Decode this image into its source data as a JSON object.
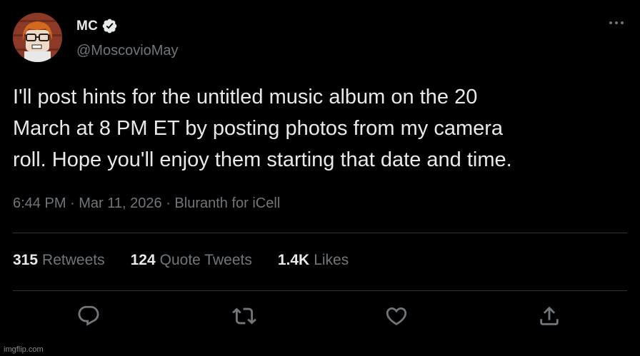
{
  "author": {
    "display_name": "MC",
    "handle": "@MoscovioMay",
    "verified": true
  },
  "tweet": {
    "lines": [
      "I'll post hints for the untitled music album on the 20",
      "March at 8 PM ET by posting photos from my camera",
      "roll. Hope you'll enjoy them starting that date and time."
    ]
  },
  "meta": {
    "time": "6:44 PM",
    "separator": " · ",
    "date": "Mar 11, 2026",
    "source": "Bluranth for iCell"
  },
  "stats": [
    {
      "value": "315",
      "label": "Retweets"
    },
    {
      "value": "124",
      "label": "Quote Tweets"
    },
    {
      "value": "1.4K",
      "label": "Likes"
    }
  ],
  "actions": [
    "reply-icon",
    "retweet-icon",
    "like-icon",
    "share-icon"
  ],
  "watermark": "imgflip.com",
  "colors": {
    "background": "#000000",
    "text": "#e7e9ea",
    "muted": "#71767b",
    "divider": "#2f3336"
  }
}
